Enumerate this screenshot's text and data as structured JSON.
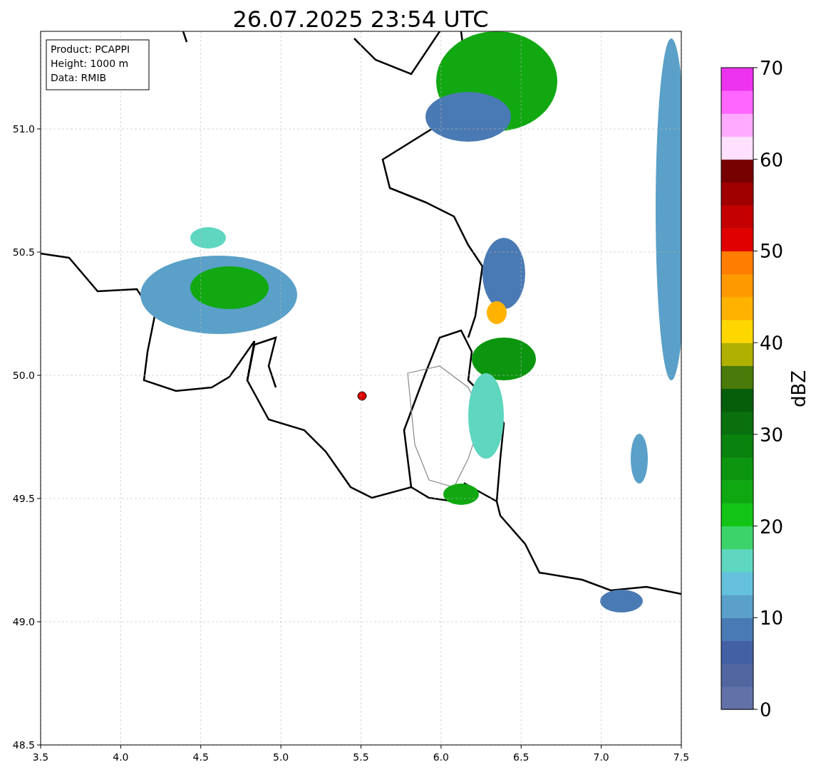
{
  "title": "26.07.2025 23:54 UTC",
  "info": [
    "Product: PCAPPI",
    "Height: 1000 m",
    "Data: RMIB"
  ],
  "xticks": [
    "3.5",
    "4.0",
    "4.5",
    "5.0",
    "5.5",
    "6.0",
    "6.5",
    "7.0",
    "7.5"
  ],
  "yticks": [
    "51.0",
    "50.5",
    "50.0",
    "49.5",
    "49.0",
    "48.5"
  ],
  "colorbar": {
    "label": "dBZ",
    "ticks": [
      "70",
      "60",
      "50",
      "40",
      "30",
      "20",
      "10",
      "0"
    ],
    "segments": [
      {
        "color": "#6272a8"
      },
      {
        "color": "#5266a0"
      },
      {
        "color": "#4460a4"
      },
      {
        "color": "#4a7ab4"
      },
      {
        "color": "#5aa0c8"
      },
      {
        "color": "#64c0dc"
      },
      {
        "color": "#5ed6c0"
      },
      {
        "color": "#3cd46a"
      },
      {
        "color": "#11c416"
      },
      {
        "color": "#0fa812"
      },
      {
        "color": "#0c960f"
      },
      {
        "color": "#0a820e"
      },
      {
        "color": "#0a700e"
      },
      {
        "color": "#065e0a"
      },
      {
        "color": "#4a7a0a"
      },
      {
        "color": "#b0b000"
      },
      {
        "color": "#ffd700"
      },
      {
        "color": "#ffb300"
      },
      {
        "color": "#ff9900"
      },
      {
        "color": "#ff7d00"
      },
      {
        "color": "#e00000"
      },
      {
        "color": "#c40000"
      },
      {
        "color": "#a00000"
      },
      {
        "color": "#770000"
      },
      {
        "color": "#ffe0ff"
      },
      {
        "color": "#ffaaff"
      },
      {
        "color": "#ff66ff"
      },
      {
        "color": "#ee33ee"
      }
    ]
  }
}
